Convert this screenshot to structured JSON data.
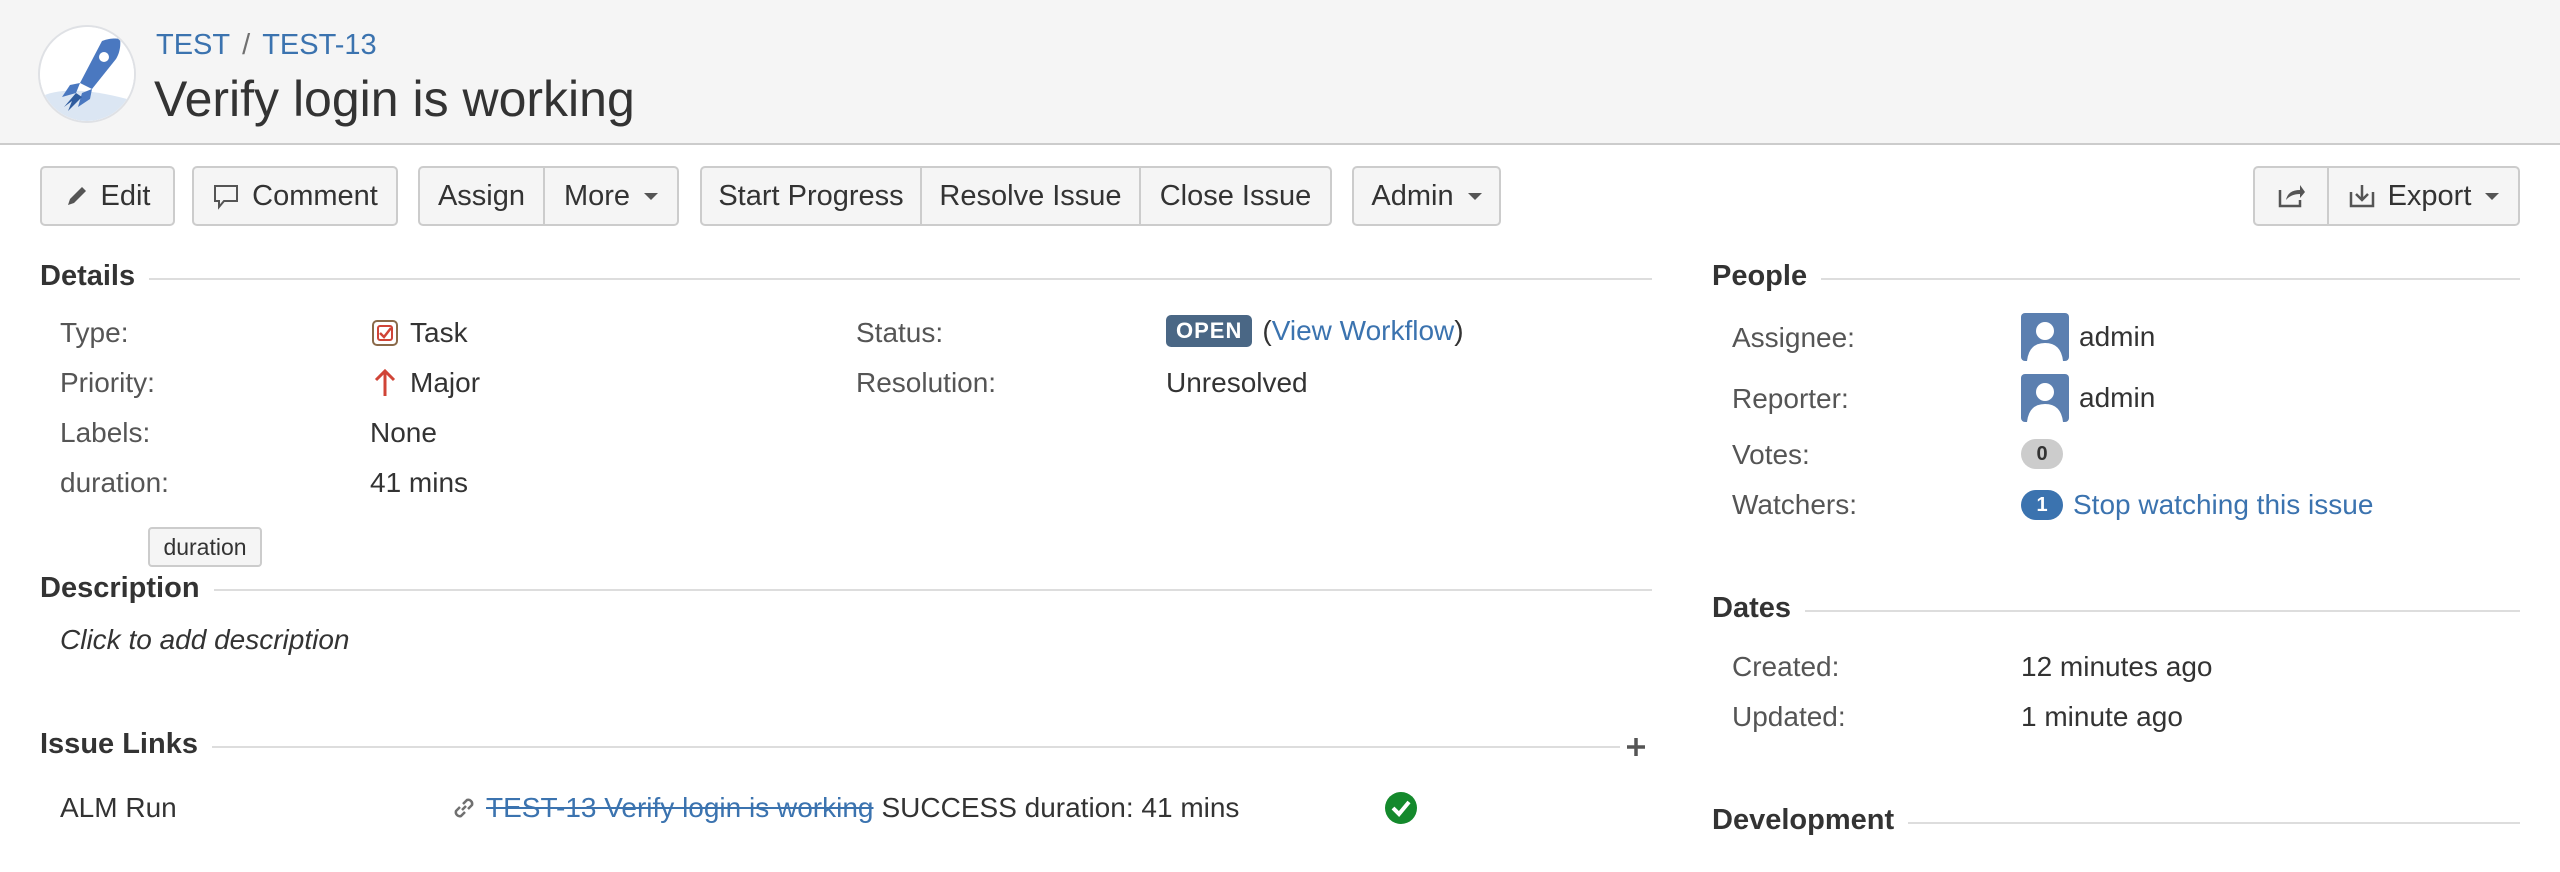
{
  "header": {
    "project": "TEST",
    "separator": "/",
    "issue_key": "TEST-13",
    "summary": "Verify login is working"
  },
  "toolbar": {
    "edit": "Edit",
    "comment": "Comment",
    "assign": "Assign",
    "more": "More",
    "start_progress": "Start Progress",
    "resolve_issue": "Resolve Issue",
    "close_issue": "Close Issue",
    "admin": "Admin",
    "export": "Export"
  },
  "details": {
    "heading": "Details",
    "type_label": "Type:",
    "type_value": "Task",
    "priority_label": "Priority:",
    "priority_value": "Major",
    "labels_label": "Labels:",
    "labels_value": "None",
    "duration_label": "duration:",
    "duration_value": "41 mins",
    "status_label": "Status:",
    "status_value": "OPEN",
    "status_open_paren": "(",
    "view_workflow": "View Workflow",
    "status_close_paren": ")",
    "resolution_label": "Resolution:",
    "resolution_value": "Unresolved",
    "tooltip": "duration"
  },
  "description": {
    "heading": "Description",
    "placeholder": "Click to add description"
  },
  "issue_links": {
    "heading": "Issue Links",
    "type": "ALM Run",
    "linked_issue": "TEST-13 Verify login is working",
    "result_text": "SUCCESS duration: 41 mins"
  },
  "people": {
    "heading": "People",
    "assignee_label": "Assignee:",
    "assignee_value": "admin",
    "reporter_label": "Reporter:",
    "reporter_value": "admin",
    "votes_label": "Votes:",
    "votes_count": "0",
    "watchers_label": "Watchers:",
    "watchers_count": "1",
    "stop_watching": "Stop watching this issue"
  },
  "dates": {
    "heading": "Dates",
    "created_label": "Created:",
    "created_value": "12 minutes ago",
    "updated_label": "Updated:",
    "updated_value": "1 minute ago"
  },
  "development": {
    "heading": "Development"
  },
  "colors": {
    "link": "#3b73af",
    "status_lozenge": "#4a6785",
    "success": "#14892c",
    "priority_major": "#d04437"
  }
}
